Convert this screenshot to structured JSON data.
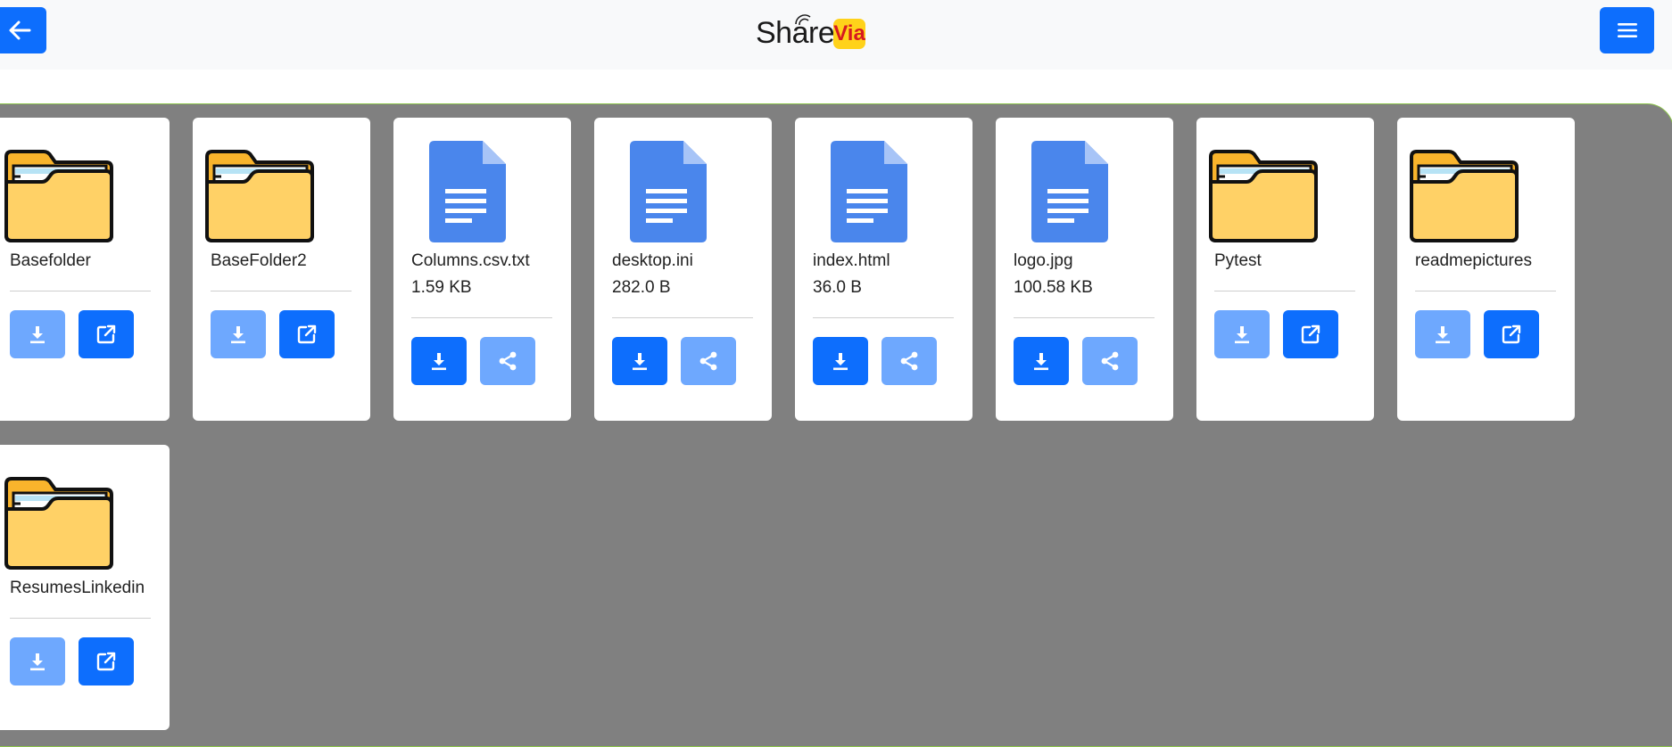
{
  "header": {
    "back_icon": "arrow-left-icon",
    "menu_icon": "hamburger-menu-icon",
    "logo": {
      "text_main": "Share",
      "text_badge": "Via"
    }
  },
  "colors": {
    "primary": "#0d6efd",
    "primary_light": "#6ea8fe",
    "folder": "#ffd166",
    "folder_dark": "#f9b42c",
    "doc": "#4a86ec",
    "grid_background": "#808080"
  },
  "items": [
    {
      "name": "Basefolder",
      "type": "folder",
      "size": ""
    },
    {
      "name": "BaseFolder2",
      "type": "folder",
      "size": ""
    },
    {
      "name": "Columns.csv.txt",
      "type": "file",
      "size": "1.59 KB"
    },
    {
      "name": "desktop.ini",
      "type": "file",
      "size": "282.0 B"
    },
    {
      "name": "index.html",
      "type": "file",
      "size": "36.0 B"
    },
    {
      "name": "logo.jpg",
      "type": "file",
      "size": "100.58 KB"
    },
    {
      "name": "Pytest",
      "type": "folder",
      "size": ""
    },
    {
      "name": "readmepictures",
      "type": "folder",
      "size": ""
    },
    {
      "name": "ResumesLinkedin",
      "type": "folder",
      "size": ""
    }
  ],
  "icons": {
    "folder_actions": [
      "download-icon",
      "open-external-icon"
    ],
    "file_actions": [
      "download-icon",
      "share-icon"
    ]
  }
}
